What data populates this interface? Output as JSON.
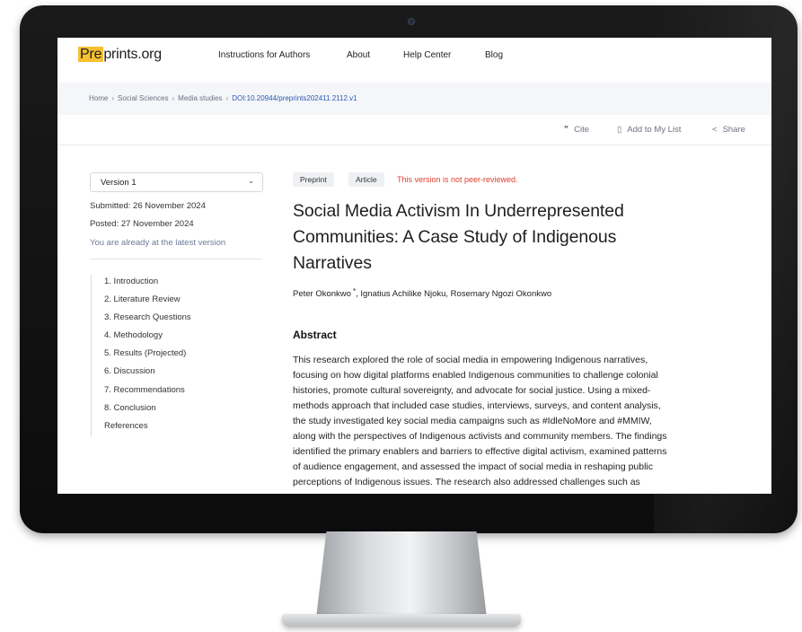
{
  "header": {
    "logo_highlight": "Pre",
    "logo_rest": "prints.org",
    "nav": [
      "Instructions for Authors",
      "About",
      "Help Center",
      "Blog"
    ]
  },
  "breadcrumb": [
    "Home",
    "Social Sciences",
    "Media studies",
    "DOI:10.20944/preprints202411.2112.v1"
  ],
  "actions": {
    "cite": "Cite",
    "add_to_list": "Add to My List",
    "share": "Share"
  },
  "sidebar": {
    "version": "Version 1",
    "submitted": "Submitted: 26 November 2024",
    "posted": "Posted: 27 November 2024",
    "latest_note": "You are already at the latest version",
    "toc": [
      "1. Introduction",
      "2. Literature Review",
      "3. Research Questions",
      "4. Methodology",
      "5. Results (Projected)",
      "6. Discussion",
      "7. Recommendations",
      "8. Conclusion",
      "References"
    ]
  },
  "article": {
    "tags": [
      "Preprint",
      "Article"
    ],
    "review_notice": "This version is not peer-reviewed.",
    "title_lines": [
      "Social Media Activism In Underrepresented",
      "Communities: A Case Study of Indigenous",
      "Narratives"
    ],
    "authors": {
      "first": "Peter Okonkwo",
      "star": "*",
      "rest": ",  Ignatius Achilike Njoku,  Rosemary Ngozi Okonkwo"
    },
    "abstract_heading": "Abstract",
    "abstract_lines": [
      "This research explored the role of social media in empowering Indigenous narratives,",
      "focusing on how digital platforms enabled Indigenous communities to challenge colonial",
      "histories, promote cultural sovereignty, and advocate for social justice. Using a mixed-",
      "methods approach that included case studies, interviews, surveys, and content analysis,",
      "the study investigated key social media campaigns such as #IdleNoMore and #MMIW,",
      "along with the perspectives of Indigenous activists and community members. The findings",
      "identified the primary enablers and barriers to effective digital activism, examined patterns",
      "of audience engagement, and assessed the impact of social media in reshaping public",
      "perceptions of Indigenous issues. The research also addressed challenges such as"
    ]
  },
  "icons": {
    "cite": "quote-icon",
    "bookmark": "bookmark-icon",
    "share": "share-icon",
    "chevron": "chevron-down-icon"
  },
  "colors": {
    "logo_highlight": "#f6c02f",
    "notice_red": "#e0402e",
    "link_blue": "#2a5ab8",
    "monitor_bezel": "#111111"
  }
}
